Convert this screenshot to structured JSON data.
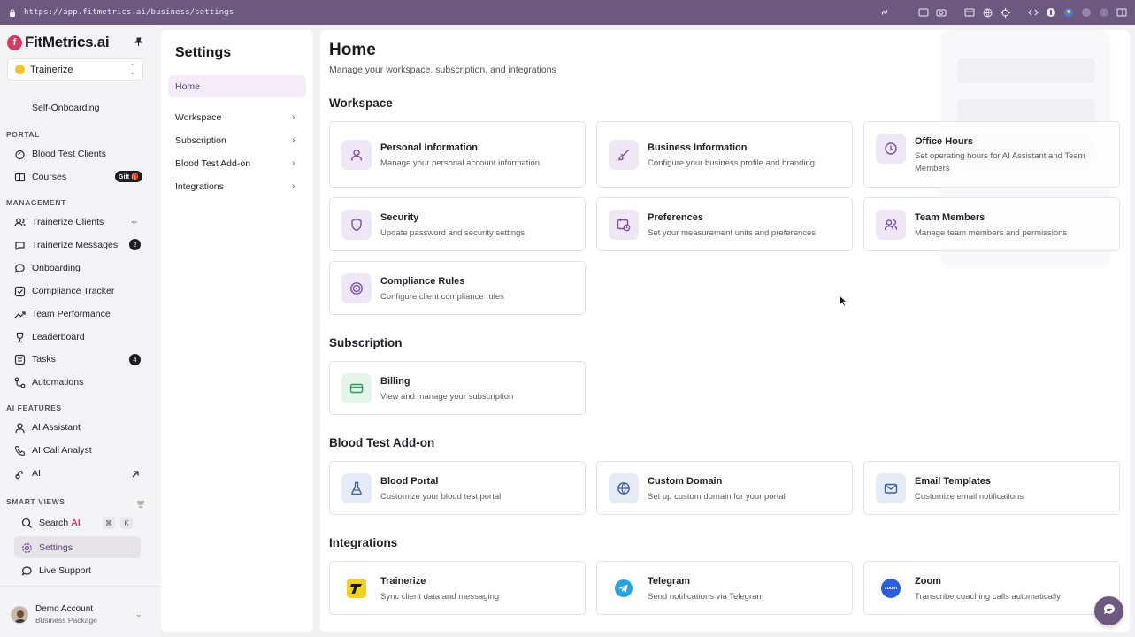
{
  "browser": {
    "url": "https://app.fitmetrics.ai/business/settings"
  },
  "brand": {
    "logo_letter": "f",
    "name": "FitMetrics.ai"
  },
  "workspace_select": {
    "value": "Trainerize"
  },
  "sidebar": {
    "self_onboarding": "Self-Onboarding",
    "portal_label": "PORTAL",
    "portal_items": [
      {
        "label": "Blood Test Clients",
        "icon": "droplet-icon"
      },
      {
        "label": "Courses",
        "icon": "book-icon",
        "badge": "Gift 🎁"
      }
    ],
    "management_label": "MANAGEMENT",
    "management_items": [
      {
        "label": "Trainerize Clients",
        "icon": "users-icon",
        "action": "+"
      },
      {
        "label": "Trainerize Messages",
        "icon": "message-icon",
        "badge": "2"
      },
      {
        "label": "Onboarding",
        "icon": "chat-bubble-icon"
      },
      {
        "label": "Compliance Tracker",
        "icon": "check-square-icon"
      },
      {
        "label": "Team Performance",
        "icon": "trend-icon"
      },
      {
        "label": "Leaderboard",
        "icon": "trophy-icon"
      },
      {
        "label": "Tasks",
        "icon": "list-icon",
        "badge": "4"
      },
      {
        "label": "Automations",
        "icon": "workflow-icon"
      }
    ],
    "ai_label": "AI FEATURES",
    "ai_items": [
      {
        "label": "AI Assistant",
        "icon": "user-icon"
      },
      {
        "label": "AI Call Analyst",
        "icon": "phone-icon"
      },
      {
        "label": "AI",
        "icon": "sparkle-icon"
      }
    ],
    "smart_label": "SMART VIEWS",
    "search": {
      "label": "Search",
      "label_ai": "AI",
      "kbd1": "⌘",
      "kbd2": "K"
    },
    "settings": "Settings",
    "live_support": "Live Support",
    "account": {
      "name": "Demo Account",
      "plan": "Business Package"
    }
  },
  "settings_nav": {
    "title": "Settings",
    "items": [
      {
        "label": "Home"
      },
      {
        "label": "Workspace"
      },
      {
        "label": "Subscription"
      },
      {
        "label": "Blood Test Add-on"
      },
      {
        "label": "Integrations"
      }
    ]
  },
  "main": {
    "title": "Home",
    "subtitle": "Manage your workspace, subscription, and integrations",
    "sections": {
      "workspace": "Workspace",
      "subscription": "Subscription",
      "blood": "Blood Test Add-on",
      "integrations": "Integrations"
    },
    "cards": {
      "personal": {
        "title": "Personal Information",
        "desc": "Manage your personal account information"
      },
      "business": {
        "title": "Business Information",
        "desc": "Configure your business profile and branding"
      },
      "office": {
        "title": "Office Hours",
        "desc": "Set operating hours for AI Assistant and Team Members"
      },
      "security": {
        "title": "Security",
        "desc": "Update password and security settings"
      },
      "preferences": {
        "title": "Preferences",
        "desc": "Set your measurement units and preferences"
      },
      "team": {
        "title": "Team Members",
        "desc": "Manage team members and permissions"
      },
      "compliance": {
        "title": "Compliance Rules",
        "desc": "Configure client compliance rules"
      },
      "billing": {
        "title": "Billing",
        "desc": "View and manage your subscription"
      },
      "blood_portal": {
        "title": "Blood Portal",
        "desc": "Customize your blood test portal"
      },
      "domain": {
        "title": "Custom Domain",
        "desc": "Set up custom domain for your portal"
      },
      "email": {
        "title": "Email Templates",
        "desc": "Customize email notifications"
      },
      "trainerize": {
        "title": "Trainerize",
        "desc": "Sync client data and messaging"
      },
      "telegram": {
        "title": "Telegram",
        "desc": "Send notifications via Telegram"
      },
      "zoom": {
        "title": "Zoom",
        "desc": "Transcribe coaching calls automatically",
        "logo_text": "zoom"
      }
    }
  },
  "colors": {
    "accent": "#6d5880",
    "brand": "#d93a63",
    "icon_purple": "#7a4fa0",
    "icon_green": "#2f9e5a",
    "icon_blue": "#3d5fa8"
  }
}
